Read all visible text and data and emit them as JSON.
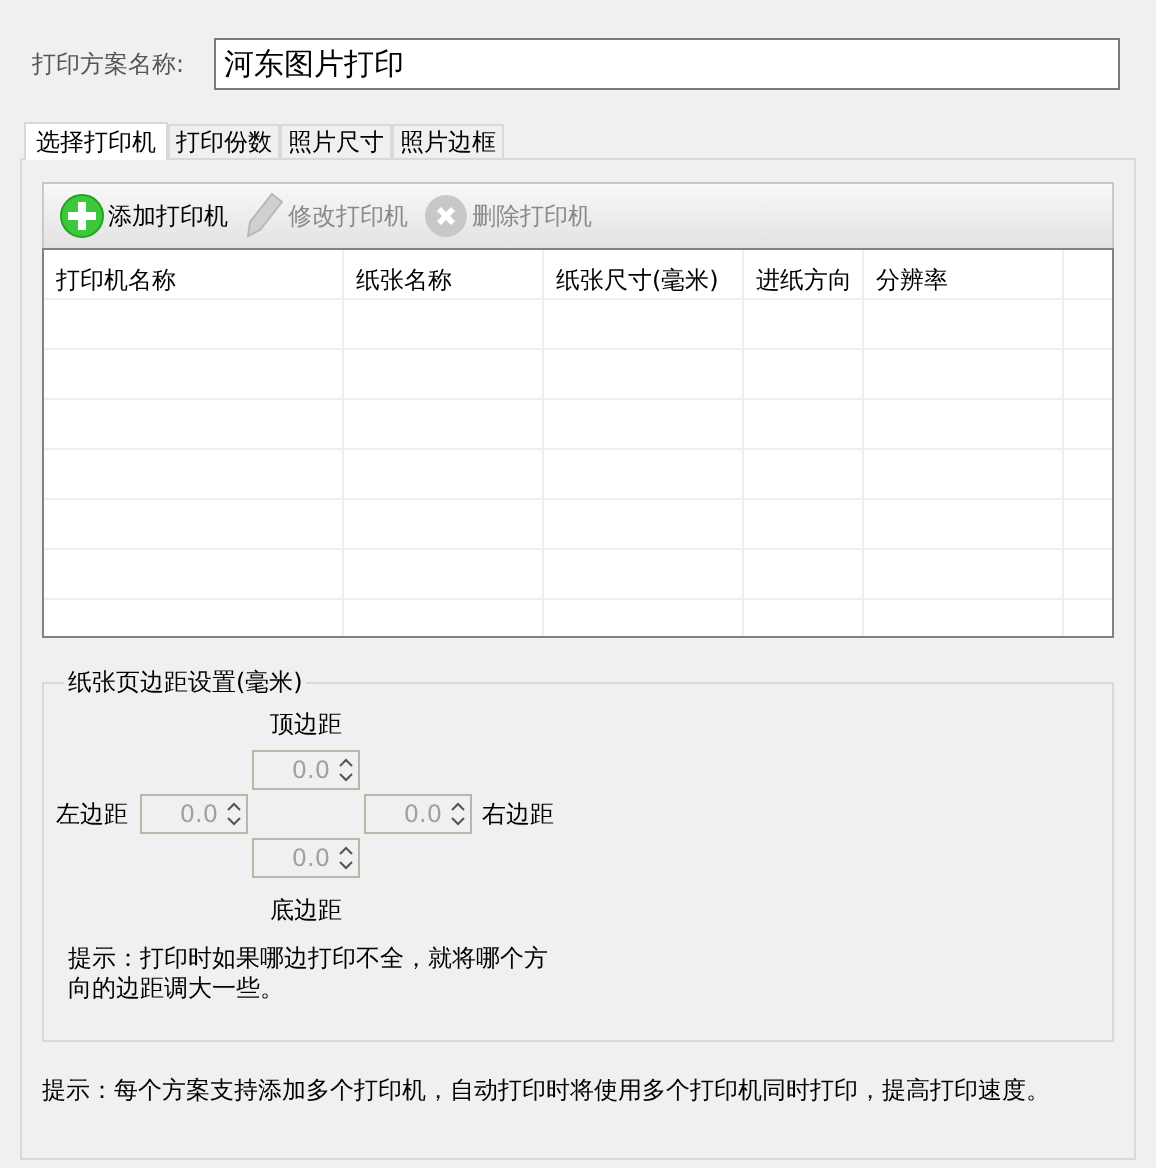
{
  "scheme": {
    "label": "打印方案名称:",
    "value": "河东图片打印"
  },
  "tabs": [
    {
      "label": "选择打印机",
      "selected": true
    },
    {
      "label": "打印份数",
      "selected": false
    },
    {
      "label": "照片尺寸",
      "selected": false
    },
    {
      "label": "照片边框",
      "selected": false
    }
  ],
  "toolbar": [
    {
      "label": "添加打印机",
      "kind": "add",
      "disabled": false
    },
    {
      "label": "修改打印机",
      "kind": "edit",
      "disabled": true
    },
    {
      "label": "删除打印机",
      "kind": "delete",
      "disabled": true
    }
  ],
  "table": {
    "columns": [
      "打印机名称",
      "纸张名称",
      "纸张尺寸(毫米)",
      "进纸方向",
      "分辨率"
    ]
  },
  "margins": {
    "title": "纸张页边距设置(毫米)",
    "top": {
      "label": "顶边距",
      "value": "0.0",
      "disabled": true
    },
    "left": {
      "label": "左边距",
      "value": "0.0",
      "disabled": true
    },
    "right": {
      "label": "右边距",
      "value": "0.0",
      "disabled": true
    },
    "bottom": {
      "label": "底边距",
      "value": "0.0",
      "disabled": true
    },
    "hint": "提示：打印时如果哪边打印不全，就将哪个方向的边距调大一些。"
  },
  "footer_hint": "提示：每个方案支持添加多个打印机，自动打印时将使用多个打印机同时打印，提高打印速度。"
}
